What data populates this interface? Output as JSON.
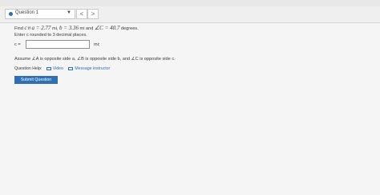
{
  "top_bar": {
    "text": ""
  },
  "question_nav": {
    "select_label": "Question 1",
    "prev_symbol": "<",
    "next_symbol": ">"
  },
  "problem": {
    "line1_prefix": "Find ",
    "line1_var": "c",
    "line1_mid1": " if ",
    "line1_a": "a = 2.77",
    "line1_mid2": " mi, ",
    "line1_b": "b = 3.36",
    "line1_mid3": " mi and ",
    "line1_angle": "∠C = 40.7",
    "line1_suffix": " degrees.",
    "line2": "Enter c rounded to 3 decimal places."
  },
  "answer": {
    "label": "c =",
    "value": "",
    "unit": "mi;"
  },
  "assumption": {
    "text": "Assume ∠A is opposite side a, ∠B is opposite side b, and ∠C is opposite side c."
  },
  "help": {
    "label": "Question Help:",
    "video": "Video",
    "message": "Message instructor"
  },
  "submit": {
    "label": "Submit Question"
  },
  "colors": {
    "accent": "#2f6fb6",
    "background": "#f5f5f5"
  }
}
